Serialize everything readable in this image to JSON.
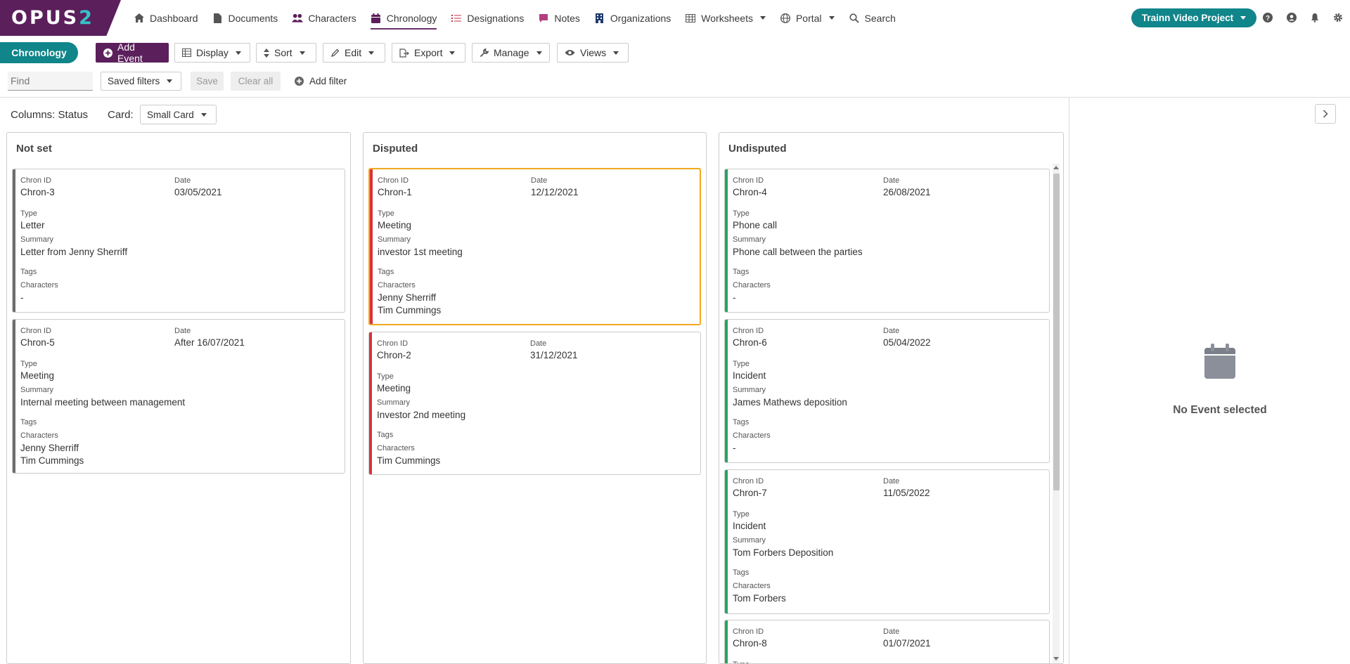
{
  "nav": {
    "logo_text": "OPUS",
    "logo_num": "2",
    "items": [
      {
        "label": "Dashboard",
        "icon": "home-icon"
      },
      {
        "label": "Documents",
        "icon": "document-icon"
      },
      {
        "label": "Characters",
        "icon": "people-icon"
      },
      {
        "label": "Chronology",
        "icon": "calendar-icon",
        "active": true
      },
      {
        "label": "Designations",
        "icon": "list-icon"
      },
      {
        "label": "Notes",
        "icon": "note-icon"
      },
      {
        "label": "Organizations",
        "icon": "building-icon"
      },
      {
        "label": "Worksheets",
        "icon": "grid-icon",
        "dropdown": true
      },
      {
        "label": "Portal",
        "icon": "globe-icon",
        "dropdown": true
      },
      {
        "label": "Search",
        "icon": "search-icon"
      }
    ],
    "project": "Trainn Video Project",
    "accent": "#10858a",
    "brand": "#5b1f5b"
  },
  "toolbar": {
    "section": "Chronology",
    "add_event": "Add Event",
    "display": "Display",
    "sort": "Sort",
    "edit": "Edit",
    "export": "Export",
    "manage": "Manage",
    "views": "Views"
  },
  "filters": {
    "find_placeholder": "Find",
    "saved_filters": "Saved filters",
    "save": "Save",
    "clear_all": "Clear all",
    "add_filter": "Add filter"
  },
  "board": {
    "columns_label": "Columns: Status",
    "card_label": "Card:",
    "card_value": "Small Card",
    "field_labels": {
      "chron_id": "Chron ID",
      "date": "Date",
      "type": "Type",
      "summary": "Summary",
      "tags": "Tags",
      "characters": "Characters"
    },
    "columns": [
      {
        "title": "Not set",
        "accent": "#6d6d6d",
        "cards": [
          {
            "id": "Chron-3",
            "date": "03/05/2021",
            "type": "Letter",
            "summary": "Letter from Jenny Sherriff",
            "characters": [
              "-"
            ]
          },
          {
            "id": "Chron-5",
            "date": "After 16/07/2021",
            "type": "Meeting",
            "summary": "Internal meeting between management",
            "characters": [
              "Jenny Sherriff",
              "Tim Cummings"
            ]
          }
        ]
      },
      {
        "title": "Disputed",
        "accent": "#d9323a",
        "cards": [
          {
            "id": "Chron-1",
            "date": "12/12/2021",
            "type": "Meeting",
            "summary": "investor 1st meeting",
            "characters": [
              "Jenny Sherriff",
              "Tim Cummings"
            ],
            "selected": true
          },
          {
            "id": "Chron-2",
            "date": "31/12/2021",
            "type": "Meeting",
            "summary": "Investor 2nd meeting",
            "characters": [
              "Tim Cummings"
            ]
          }
        ]
      },
      {
        "title": "Undisputed",
        "accent": "#27a35f",
        "cards": [
          {
            "id": "Chron-4",
            "date": "26/08/2021",
            "type": "Phone call",
            "summary": "Phone call between the parties",
            "characters": [
              "-"
            ]
          },
          {
            "id": "Chron-6",
            "date": "05/04/2022",
            "type": "Incident",
            "summary": "James Mathews deposition",
            "characters": [
              "-"
            ]
          },
          {
            "id": "Chron-7",
            "date": "11/05/2022",
            "type": "Incident",
            "summary": "Tom Forbers Deposition",
            "characters": [
              "Tom Forbers"
            ]
          },
          {
            "id": "Chron-8",
            "date": "01/07/2021",
            "type": "",
            "summary": "",
            "characters": []
          }
        ]
      }
    ]
  },
  "panel": {
    "empty_text": "No Event selected"
  }
}
